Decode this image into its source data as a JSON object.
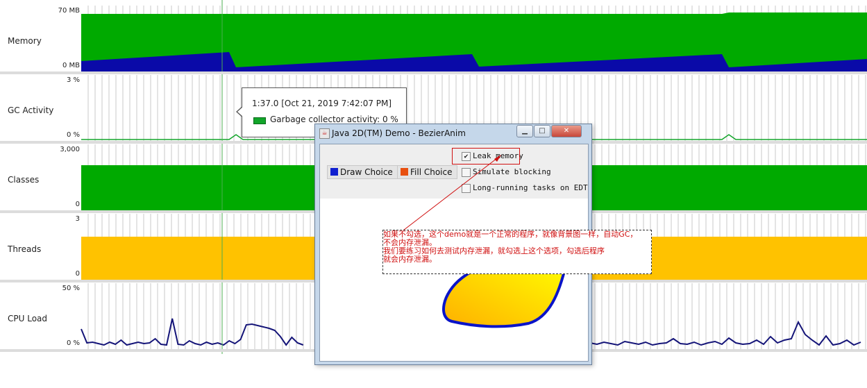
{
  "panels": [
    {
      "label": "Memory",
      "top_tick": "70 MB",
      "bottom_tick": "0 MB"
    },
    {
      "label": "GC Activity",
      "top_tick": "3 %",
      "bottom_tick": "0 %"
    },
    {
      "label": "Classes",
      "top_tick": "3,000",
      "bottom_tick": "0"
    },
    {
      "label": "Threads",
      "top_tick": "3",
      "bottom_tick": "0"
    },
    {
      "label": "CPU Load",
      "top_tick": "50 %",
      "bottom_tick": "0 %"
    }
  ],
  "tooltip": {
    "title": "1:37.0 [Oct 21, 2019 7:42:07 PM]",
    "item": "Garbage collector activity:  0 %"
  },
  "window": {
    "title": "Java 2D(TM) Demo - BezierAnim",
    "draw_choice": "Draw Choice",
    "fill_choice": "Fill Choice",
    "leak_memory": "Leak memory",
    "simulate_blocking": "Simulate blocking",
    "long_running": "Long-running tasks on EDT",
    "leak_checked": true
  },
  "annotation": {
    "line1": "如果不勾选，这个demo就是一个正常的程序，就像背景图一样，自动GC，",
    "line2": "不会内存泄漏。",
    "line3": "我们要练习如何去测试内存泄漏，就勾选上这个选项，勾选后程序",
    "line4": "就会内存泄漏。"
  },
  "colors": {
    "memory_heap": "#00aa00",
    "memory_used": "#0a0aa8",
    "threads": "#ffc200",
    "cpu": "#141478",
    "gc": "#12a52a",
    "draw_choice": "#1020d0",
    "fill_choice": "#e85010",
    "annotation": "#d01010"
  }
}
